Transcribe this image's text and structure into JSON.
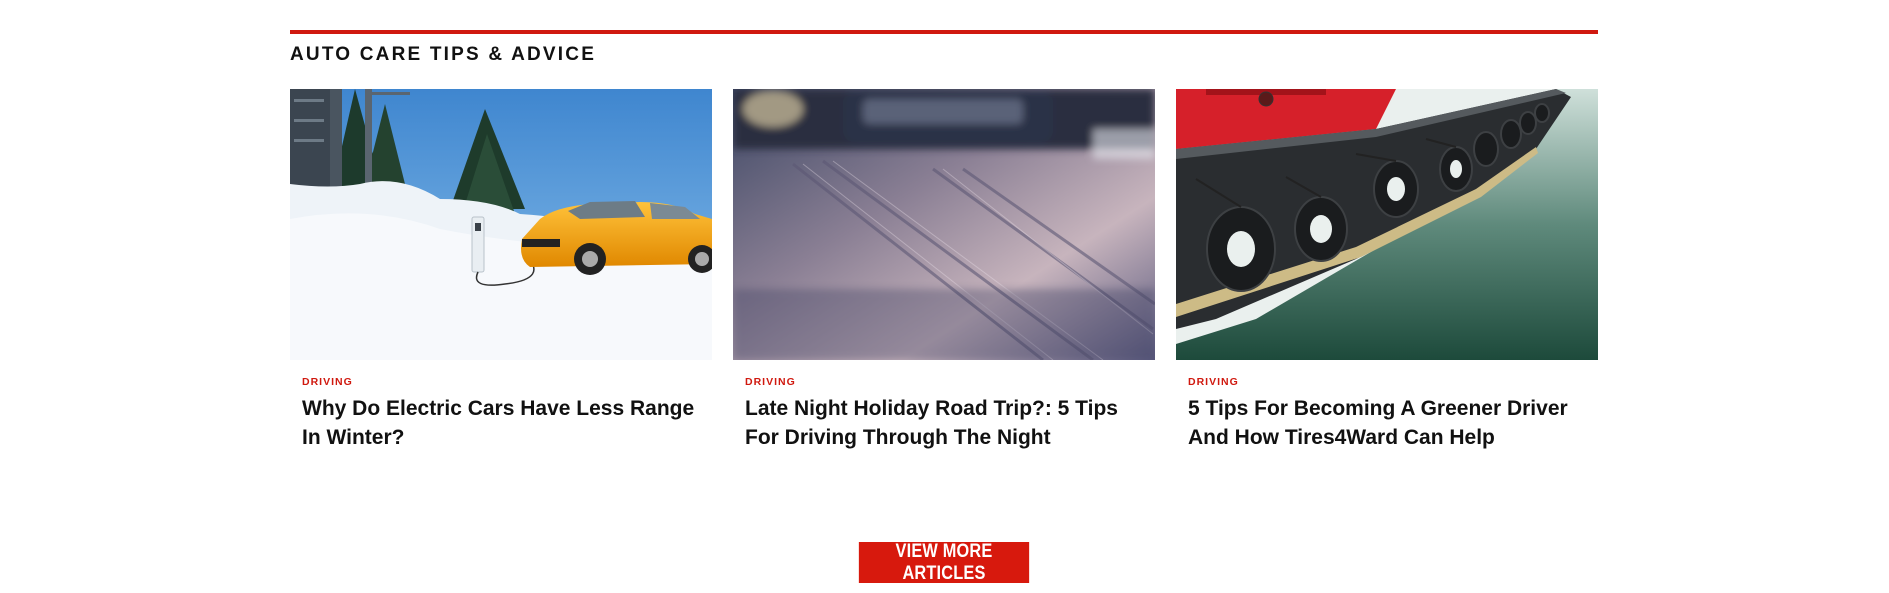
{
  "section": {
    "heading": "AUTO CARE TIPS & ADVICE",
    "accent_color": "#d0190f"
  },
  "articles": [
    {
      "category": "DRIVING",
      "title": "Why Do Electric Cars Have Less Range In Winter?",
      "image": "electric-car-in-snow-image"
    },
    {
      "category": "DRIVING",
      "title": "Late Night Holiday Road Trip?: 5 Tips For Driving Through The Night",
      "image": "snowy-road-night-image"
    },
    {
      "category": "DRIVING",
      "title": "5 Tips For Becoming A Greener Driver And How Tires4Ward Can Help",
      "image": "tugboat-tire-fenders-image"
    }
  ],
  "cta": {
    "label": "VIEW MORE ARTICLES",
    "color": "#d7190d"
  }
}
